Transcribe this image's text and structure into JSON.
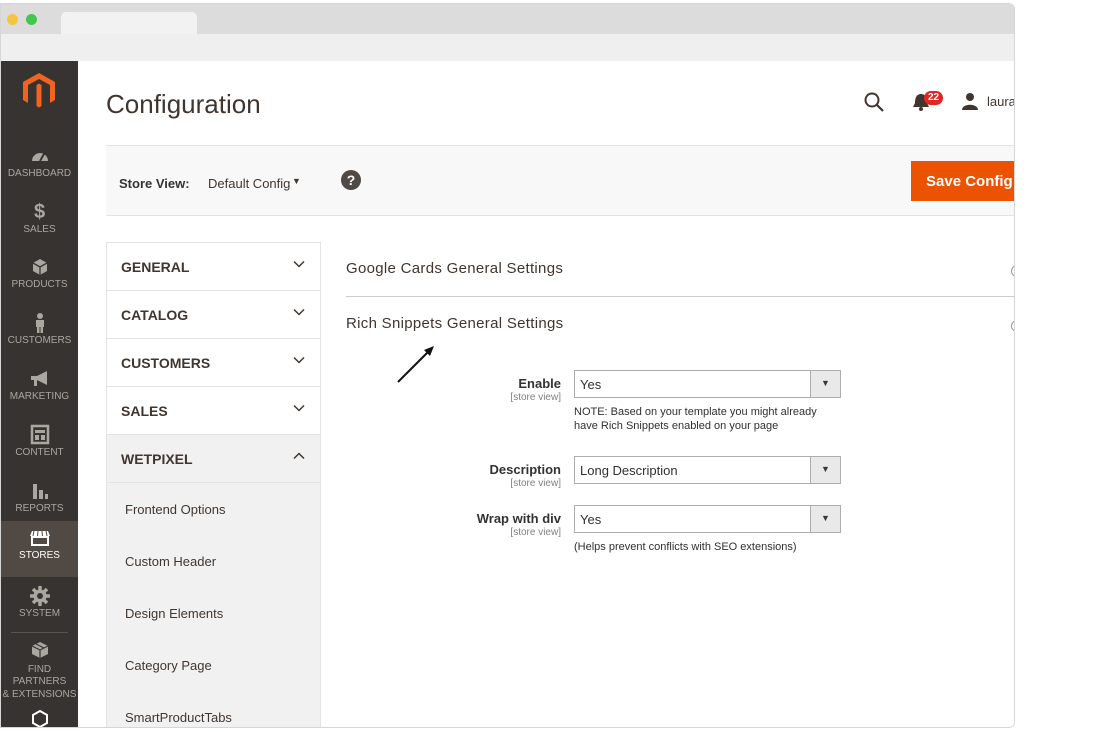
{
  "page": {
    "title": "Configuration"
  },
  "header": {
    "notification_count": "22",
    "username": "laura"
  },
  "sidebar": {
    "items": [
      {
        "label": "DASHBOARD",
        "icon": "dashboard-icon"
      },
      {
        "label": "SALES",
        "icon": "dollar-icon"
      },
      {
        "label": "PRODUCTS",
        "icon": "cube-icon"
      },
      {
        "label": "CUSTOMERS",
        "icon": "person-icon"
      },
      {
        "label": "MARKETING",
        "icon": "megaphone-icon"
      },
      {
        "label": "CONTENT",
        "icon": "layout-icon"
      },
      {
        "label": "REPORTS",
        "icon": "bar-chart-icon"
      },
      {
        "label": "STORES",
        "icon": "store-icon"
      },
      {
        "label": "SYSTEM",
        "icon": "gear-icon"
      },
      {
        "label": "FIND PARTNERS",
        "label2": "& EXTENSIONS",
        "icon": "boxes-icon"
      }
    ]
  },
  "scope": {
    "label": "Store View:",
    "value": "Default Config",
    "save_label": "Save Config"
  },
  "tabs": {
    "sections": [
      "GENERAL",
      "CATALOG",
      "CUSTOMERS",
      "SALES",
      "WETPIXEL"
    ],
    "sub_items": [
      "Frontend Options",
      "Custom Header",
      "Design Elements",
      "Category Page",
      "SmartProductTabs"
    ]
  },
  "content": {
    "section1_title": "Google Cards General Settings",
    "section2_title": "Rich Snippets General Settings",
    "fields": [
      {
        "label": "Enable",
        "scope": "[store view]",
        "value": "Yes",
        "note": "NOTE: Based on your template you might already have Rich Snippets enabled on your page"
      },
      {
        "label": "Description",
        "scope": "[store view]",
        "value": "Long Description",
        "note": ""
      },
      {
        "label": "Wrap with div",
        "scope": "[store view]",
        "value": "Yes",
        "note": "(Helps prevent conflicts with SEO extensions)"
      }
    ]
  },
  "colors": {
    "accent": "#eb5202",
    "sidebar": "#373330",
    "sidebar_active": "#514943",
    "badge": "#e22626"
  }
}
